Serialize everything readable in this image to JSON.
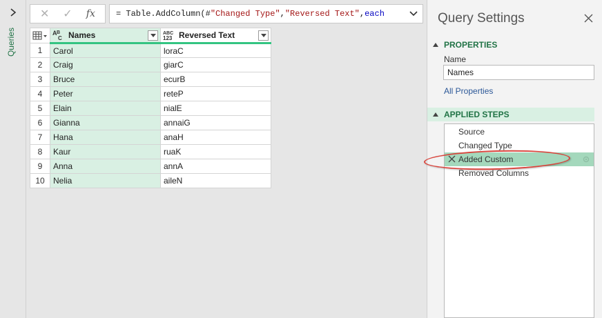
{
  "sidebar": {
    "label": "Queries"
  },
  "formula": {
    "prefix": "= Table.AddColumn(#",
    "arg1": "\"Changed Type\"",
    "sep": ", ",
    "arg2": "\"Reversed Text\"",
    "sep2": ", ",
    "keyword": "each",
    "fx_label": "fx"
  },
  "table": {
    "columns": [
      {
        "type_label": "A B C",
        "name": "Names"
      },
      {
        "type_label": "ABC 123",
        "name": "Reversed Text"
      }
    ],
    "rows": [
      {
        "n": "1",
        "names": "Carol",
        "reversed": "loraC"
      },
      {
        "n": "2",
        "names": "Craig",
        "reversed": "giarC"
      },
      {
        "n": "3",
        "names": "Bruce",
        "reversed": "ecurB"
      },
      {
        "n": "4",
        "names": "Peter",
        "reversed": "reteP"
      },
      {
        "n": "5",
        "names": "Elain",
        "reversed": "nialE"
      },
      {
        "n": "6",
        "names": "Gianna",
        "reversed": "annaiG"
      },
      {
        "n": "7",
        "names": "Hana",
        "reversed": "anaH"
      },
      {
        "n": "8",
        "names": "Kaur",
        "reversed": "ruaK"
      },
      {
        "n": "9",
        "names": "Anna",
        "reversed": "annA"
      },
      {
        "n": "10",
        "names": "Nelia",
        "reversed": "aileN"
      }
    ]
  },
  "settings": {
    "title": "Query Settings",
    "properties_header": "PROPERTIES",
    "name_label": "Name",
    "name_value": "Names",
    "all_properties": "All Properties",
    "applied_steps_header": "APPLIED STEPS",
    "steps": [
      {
        "label": "Source"
      },
      {
        "label": "Changed Type"
      },
      {
        "label": "Added Custom",
        "selected": true
      },
      {
        "label": "Removed Columns"
      }
    ]
  },
  "colors": {
    "accent_green": "#217346",
    "selected_step": "#a4d8bc",
    "column_highlight": "#d9f0e3",
    "annotation_red": "#d9443c"
  }
}
